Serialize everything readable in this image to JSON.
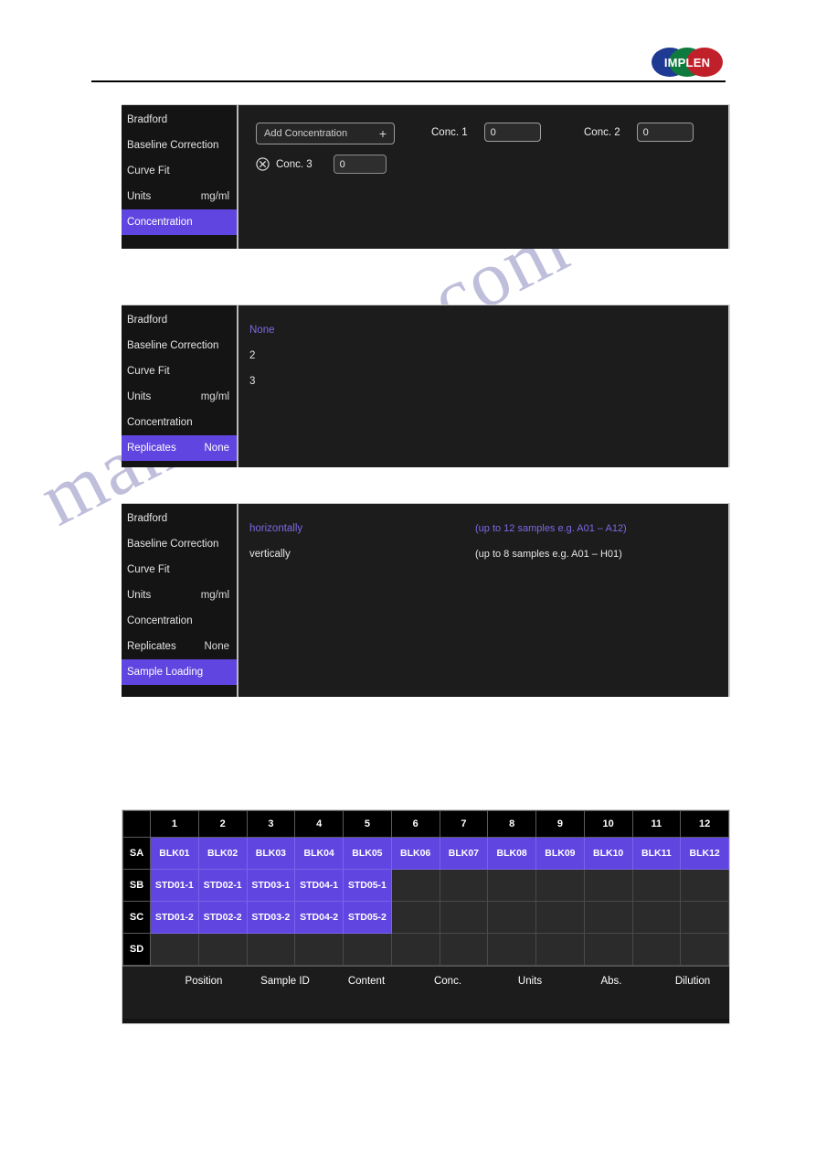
{
  "header": {
    "logo_text": "IMPLEN",
    "logo_colors": [
      "#1f3a93",
      "#0f7a3d",
      "#c0202a"
    ]
  },
  "watermark": {
    "text": "manualshive.com"
  },
  "colors": {
    "accent_purple": "#6145e0",
    "panel_bg": "#1c1c1c",
    "sidebar_bg": "#141414",
    "cell_empty": "#2b2b2b",
    "selected_text": "#7b6ae4"
  },
  "panel1": {
    "sidebar": [
      {
        "label": "Bradford",
        "value": "",
        "selected": false
      },
      {
        "label": "Baseline Correction",
        "value": "",
        "selected": false
      },
      {
        "label": "Curve Fit",
        "value": "",
        "selected": false
      },
      {
        "label": "Units",
        "value": "mg/ml",
        "selected": false
      },
      {
        "label": "Concentration",
        "value": "",
        "selected": true
      }
    ],
    "add_concentration_label": "Add Concentration",
    "add_concentration_plus": "+",
    "remove_icon": "circle-x-icon",
    "conc3_label": "Conc. 3",
    "conc3_value": "0",
    "conc1_label": "Conc. 1",
    "conc1_value": "0",
    "conc2_label": "Conc. 2",
    "conc2_value": "0"
  },
  "panel2": {
    "sidebar": [
      {
        "label": "Bradford",
        "value": "",
        "selected": false
      },
      {
        "label": "Baseline Correction",
        "value": "",
        "selected": false
      },
      {
        "label": "Curve Fit",
        "value": "",
        "selected": false
      },
      {
        "label": "Units",
        "value": "mg/ml",
        "selected": false
      },
      {
        "label": "Concentration",
        "value": "",
        "selected": false
      },
      {
        "label": "Replicates",
        "value": "None",
        "selected": true
      }
    ],
    "options": [
      {
        "label": "None",
        "hint": "",
        "selected": true
      },
      {
        "label": "2",
        "hint": "",
        "selected": false
      },
      {
        "label": "3",
        "hint": "",
        "selected": false
      }
    ]
  },
  "panel3": {
    "sidebar": [
      {
        "label": "Bradford",
        "value": "",
        "selected": false
      },
      {
        "label": "Baseline Correction",
        "value": "",
        "selected": false
      },
      {
        "label": "Curve Fit",
        "value": "",
        "selected": false
      },
      {
        "label": "Units",
        "value": "mg/ml",
        "selected": false
      },
      {
        "label": "Concentration",
        "value": "",
        "selected": false
      },
      {
        "label": "Replicates",
        "value": "None",
        "selected": false
      },
      {
        "label": "Sample Loading",
        "value": "",
        "selected": true
      }
    ],
    "options": [
      {
        "label": "horizontally",
        "hint": "(up to 12 samples e.g. A01 – A12)",
        "selected": true
      },
      {
        "label": "vertically",
        "hint": "(up to 8 samples e.g. A01 – H01)",
        "selected": false
      }
    ]
  },
  "plate": {
    "columns": [
      "1",
      "2",
      "3",
      "4",
      "5",
      "6",
      "7",
      "8",
      "9",
      "10",
      "11",
      "12"
    ],
    "rows": [
      {
        "label": "SA",
        "cells": [
          "BLK01",
          "BLK02",
          "BLK03",
          "BLK04",
          "BLK05",
          "BLK06",
          "BLK07",
          "BLK08",
          "BLK09",
          "BLK10",
          "BLK11",
          "BLK12"
        ]
      },
      {
        "label": "SB",
        "cells": [
          "STD01-1",
          "STD02-1",
          "STD03-1",
          "STD04-1",
          "STD05-1",
          "",
          "",
          "",
          "",
          "",
          "",
          ""
        ]
      },
      {
        "label": "SC",
        "cells": [
          "STD01-2",
          "STD02-2",
          "STD03-2",
          "STD04-2",
          "STD05-2",
          "",
          "",
          "",
          "",
          "",
          "",
          ""
        ]
      },
      {
        "label": "SD",
        "cells": [
          "",
          "",
          "",
          "",
          "",
          "",
          "",
          "",
          "",
          "",
          "",
          ""
        ]
      }
    ],
    "footer_headers": [
      "Position",
      "Sample ID",
      "Content",
      "Conc.",
      "Units",
      "Abs.",
      "Dilution"
    ]
  }
}
